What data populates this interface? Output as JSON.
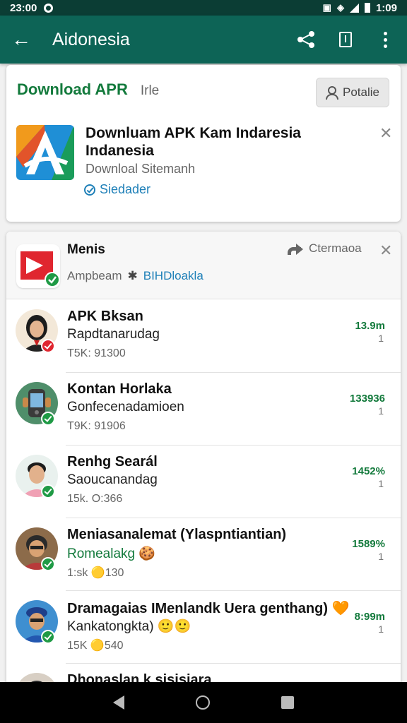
{
  "status_bar": {
    "time": "23:00",
    "clock": "1:09"
  },
  "app_bar": {
    "title": "Aidonesia"
  },
  "card_download": {
    "title": "Download APR",
    "subtitle": "Irle",
    "profile_label": "Potalie",
    "app_name": "Downluam APK Kam Indaresia Indanesia",
    "app_sub": "Downloal Sitemanh",
    "status": "Siedader"
  },
  "channel": {
    "name": "Menis",
    "meta_left": "Ampbeam",
    "meta_tag": "BIHDloakla",
    "forward_label": "Ctermaoa"
  },
  "rows": [
    {
      "title": "APK Bksan",
      "sub": "Rapdtanarudag",
      "meta": "T5K: 91300",
      "value": "13.9m",
      "num": "1",
      "badge": "#e0262f"
    },
    {
      "title": "Kontan Horlaka",
      "sub": "Gonfecenadamioen",
      "meta": "T9K: 91906",
      "value": "133936",
      "num": "1",
      "badge": "#1f9a45"
    },
    {
      "title": "Renhg Searál",
      "sub": "Saoucanandag",
      "meta": "15k. O:366",
      "value": "1452%",
      "num": "1",
      "badge": "#1f9a45"
    },
    {
      "title": "Meniasanalemat (Ylaspntiantian)",
      "sub": "Romealakg 🍪",
      "meta": "1:sk 🟡130",
      "value": "1589%",
      "num": "1",
      "badge": "#1f9a45"
    },
    {
      "title": "Dramagaias IMenlandk Uera genthang) 🧡",
      "sub": "Kankatongkta) 🙂🙂",
      "meta": "15K 🟡540",
      "value": "8:99m",
      "num": "1",
      "badge": "#1f9a45"
    },
    {
      "title": "Dhonaslan k sisisiara",
      "sub": "",
      "meta": "",
      "value": "",
      "num": "",
      "badge": "#1f9a45"
    }
  ]
}
